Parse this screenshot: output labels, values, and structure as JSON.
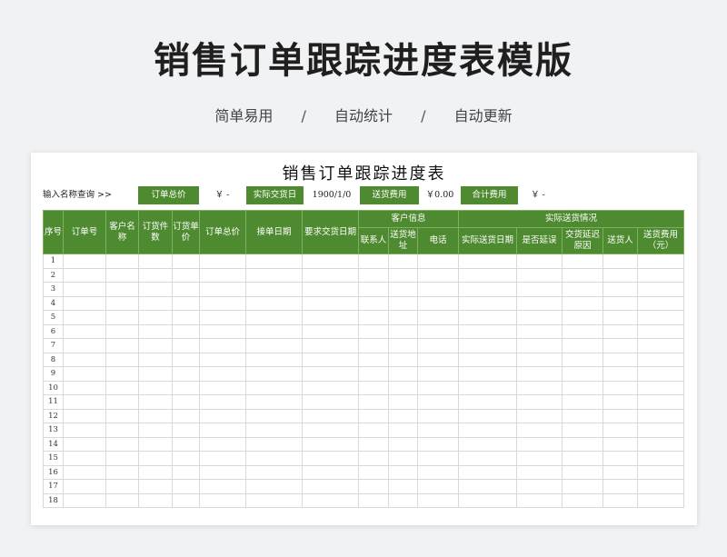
{
  "page": {
    "title": "销售订单跟踪进度表模版",
    "subtitle": [
      "简单易用",
      "自动统计",
      "自动更新"
    ],
    "separator": "/"
  },
  "sheet": {
    "title": "销售订单跟踪进度表",
    "summary": {
      "search_label": "输入名称查询 >>",
      "order_total_label": "订单总价",
      "order_total_value": "￥   -",
      "actual_date_label": "实际交货日",
      "actual_date_value": "1900/1/0",
      "shipping_label": "送货费用",
      "shipping_value": "￥0.00",
      "sum_label": "合计费用",
      "sum_value": "￥   -"
    },
    "groups": {
      "customer_info": "客户信息",
      "actual_delivery": "实际送货情况"
    },
    "columns": [
      "序号",
      "订单号",
      "客户名称",
      "订货件数",
      "订货单价",
      "订单总价",
      "接单日期",
      "要求交货日期",
      "联系人",
      "送货地址",
      "电话",
      "实际送货日期",
      "是否延误",
      "交货延迟原因",
      "送货人",
      "送货费用（元）"
    ],
    "rows": [
      "1",
      "2",
      "3",
      "4",
      "5",
      "6",
      "7",
      "8",
      "9",
      "10",
      "11",
      "12",
      "13",
      "14",
      "15",
      "16",
      "17",
      "18"
    ]
  },
  "colors": {
    "header_green": "#4e8a2f",
    "background": "#f1f2f4"
  }
}
